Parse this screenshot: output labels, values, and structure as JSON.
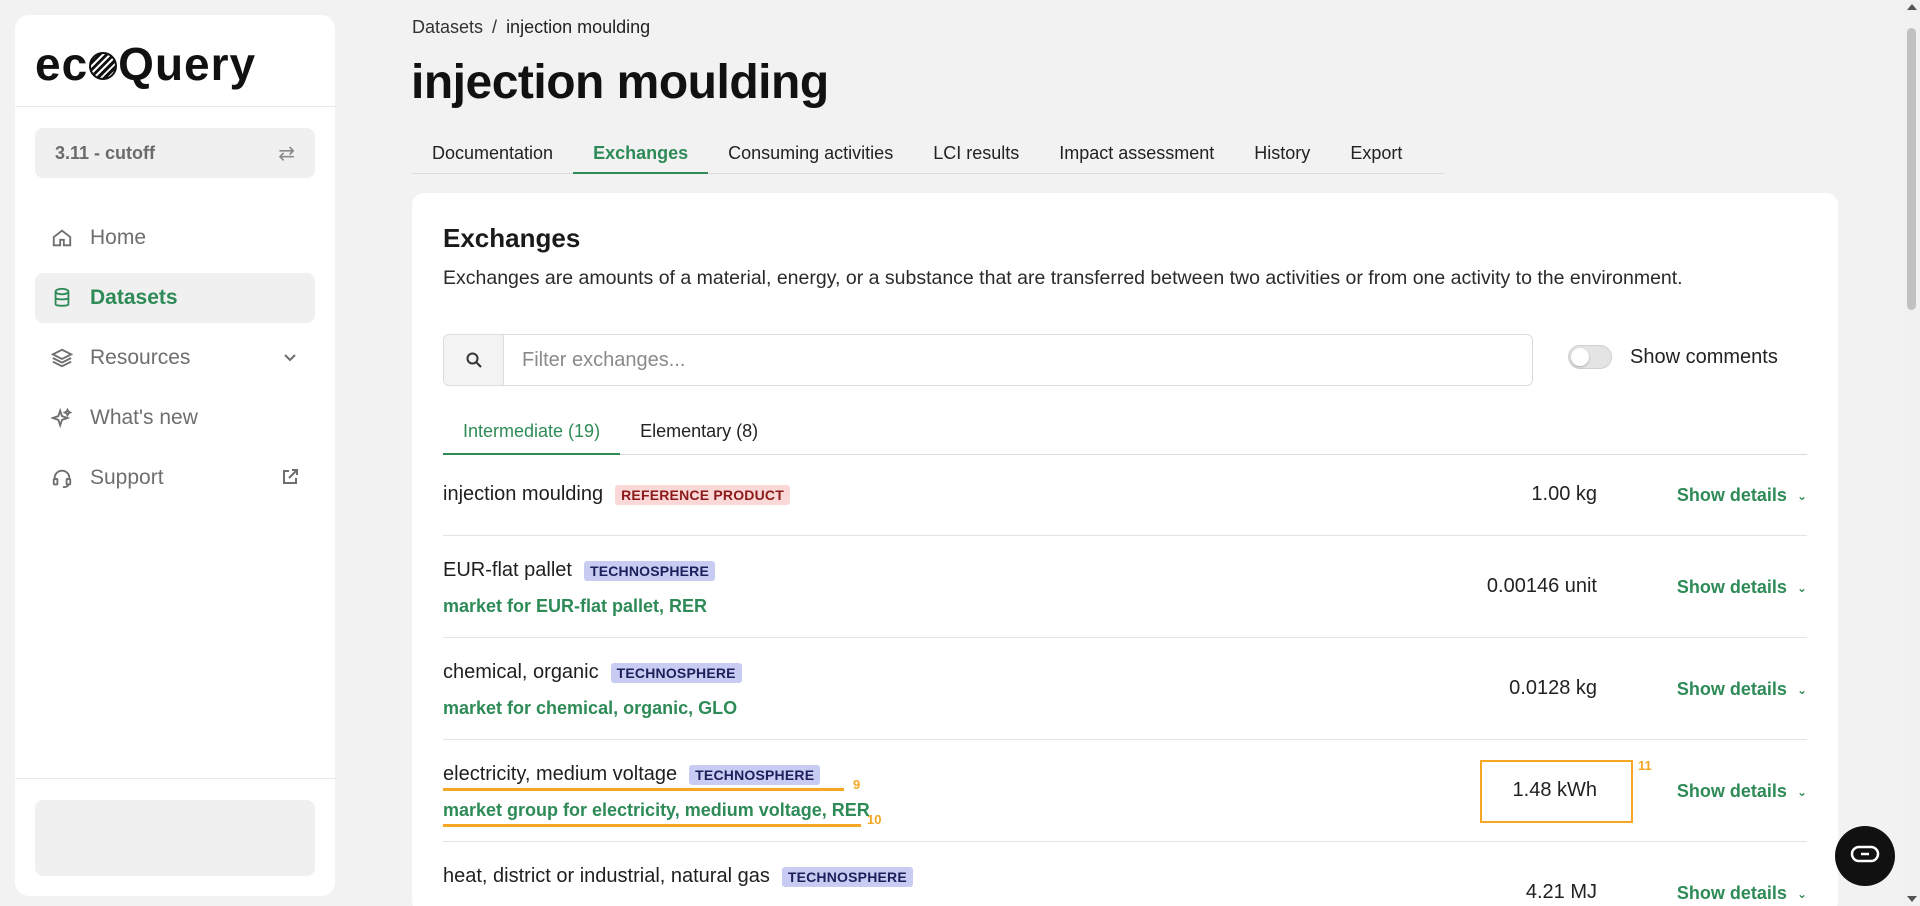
{
  "brand": {
    "logo_prefix": "ec",
    "logo_suffix": "Query"
  },
  "sidebar": {
    "version": "3.11 - cutoff",
    "items": [
      {
        "label": "Home"
      },
      {
        "label": "Datasets"
      },
      {
        "label": "Resources"
      },
      {
        "label": "What's new"
      },
      {
        "label": "Support"
      }
    ]
  },
  "breadcrumb": {
    "root": "Datasets",
    "separator": "/",
    "current": "injection moulding"
  },
  "page": {
    "title": "injection moulding"
  },
  "tabs": [
    "Documentation",
    "Exchanges",
    "Consuming activities",
    "LCI results",
    "Impact assessment",
    "History",
    "Export"
  ],
  "exchanges": {
    "title": "Exchanges",
    "description": "Exchanges are amounts of a material, energy, or a substance that are transferred between two activities or from one activity to the environment.",
    "search_placeholder": "Filter exchanges...",
    "toggle_label": "Show comments",
    "subtabs": [
      "Intermediate (19)",
      "Elementary (8)"
    ],
    "details_label": "Show details",
    "rows": [
      {
        "name": "injection moulding",
        "badge": "REFERENCE PRODUCT",
        "amount": "1.00 kg"
      },
      {
        "name": "EUR-flat pallet",
        "badge": "TECHNOSPHERE",
        "link": "market for EUR-flat pallet, RER",
        "amount": "0.00146 unit"
      },
      {
        "name": "chemical, organic",
        "badge": "TECHNOSPHERE",
        "link": "market for chemical, organic, GLO",
        "amount": "0.0128 kg"
      },
      {
        "name": "electricity, medium voltage",
        "badge": "TECHNOSPHERE",
        "link": "market group for electricity, medium voltage, RER",
        "amount": "1.48 kWh"
      },
      {
        "name": "heat, district or industrial, natural gas",
        "badge": "TECHNOSPHERE",
        "amount": "4.21 MJ"
      }
    ]
  },
  "highlights": {
    "n9": "9",
    "n10": "10",
    "n11": "11"
  },
  "colors": {
    "accent": "#2e8b57",
    "highlight": "#f5a623",
    "reference_badge": "#fbd8d8",
    "technosphere_badge": "#c8ccf2"
  }
}
